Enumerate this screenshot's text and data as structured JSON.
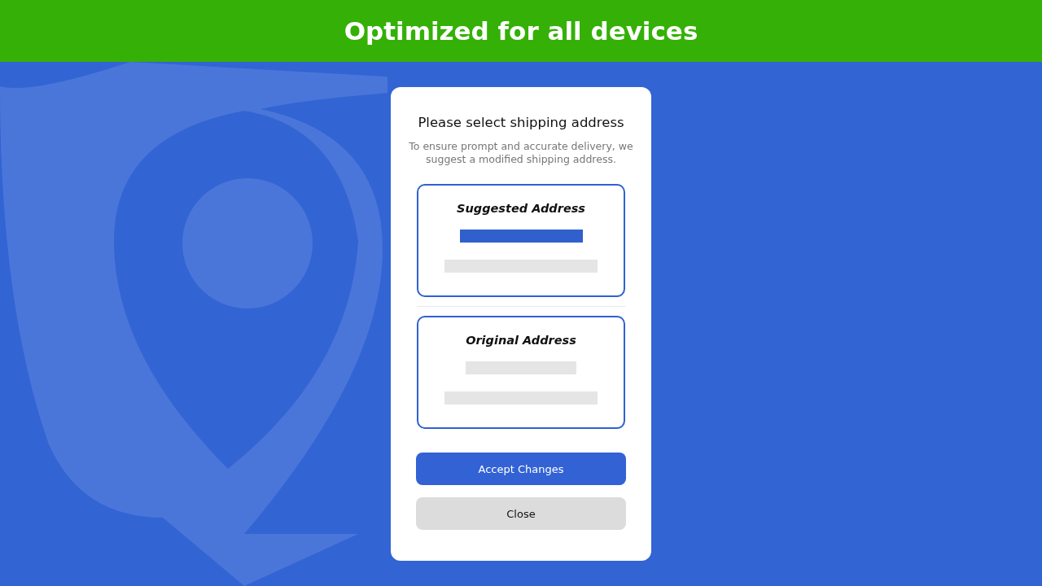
{
  "banner": {
    "title": "Optimized for all devices"
  },
  "dialog": {
    "title": "Please select shipping address",
    "message": "To ensure prompt and accurate delivery, we suggest a modified shipping address.",
    "addresses": [
      {
        "title": "Suggested Address",
        "lines": [
          {
            "highlighted": true
          },
          {
            "highlighted": false
          }
        ]
      },
      {
        "title": "Original Address",
        "lines": [
          {
            "highlighted": false
          },
          {
            "highlighted": false
          }
        ]
      }
    ],
    "buttons": [
      {
        "label": "Accept Changes",
        "kind": "primary"
      },
      {
        "label": "Close",
        "kind": "secondary"
      }
    ]
  }
}
